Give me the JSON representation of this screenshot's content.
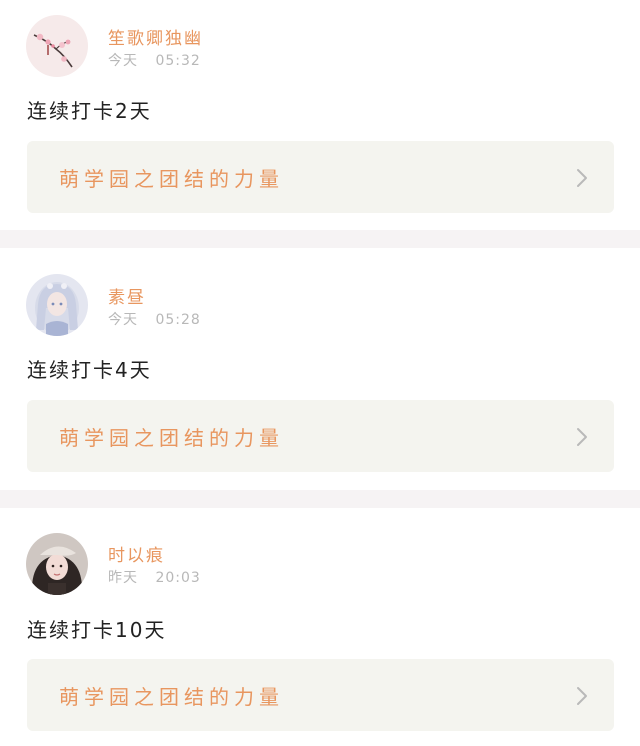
{
  "posts": [
    {
      "username": "笙歌卿独幽",
      "day": "今天",
      "time": "05:32",
      "checkin": "连续打卡2天",
      "group": "萌学园之团结的力量"
    },
    {
      "username": "素昼",
      "day": "今天",
      "time": "05:28",
      "checkin": "连续打卡4天",
      "group": "萌学园之团结的力量"
    },
    {
      "username": "时以痕",
      "day": "昨天",
      "time": "20:03",
      "checkin": "连续打卡10天",
      "group": "萌学园之团结的力量"
    }
  ],
  "icons": {
    "avatar_1": "plum-blossom-avatar",
    "avatar_2": "anime-girl-avatar",
    "avatar_3": "girl-with-beret-avatar",
    "chevron": "chevron-right-icon"
  },
  "colors": {
    "accent": "#e8965f",
    "card_bg": "#f4f4ef",
    "timestamp": "#b8b8b8",
    "text": "#222222",
    "divider": "#f6f3f4"
  }
}
